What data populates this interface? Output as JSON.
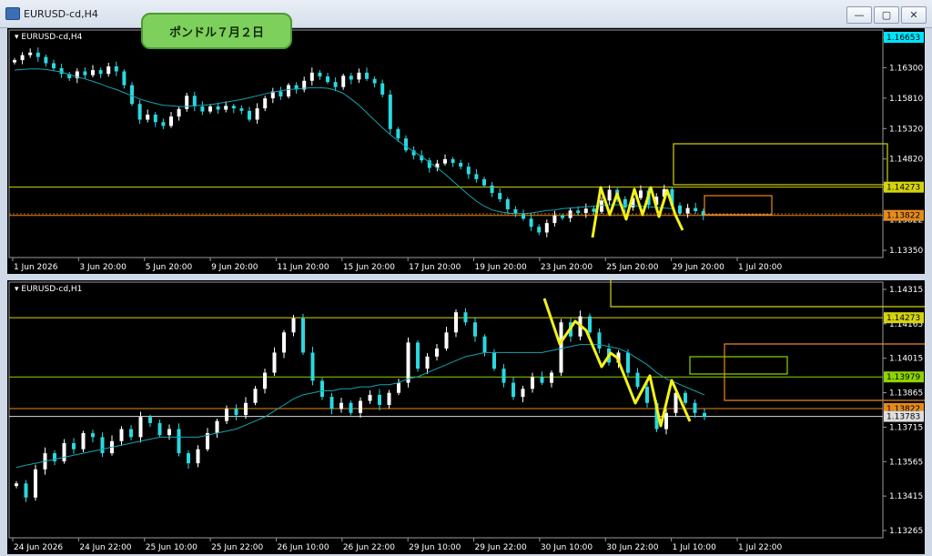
{
  "window": {
    "title": "EURUSD-cd,H4",
    "badge_text": "ポンドル７月２日",
    "controls": [
      "—",
      "▢",
      "✕"
    ]
  },
  "colors": {
    "bull": "#ffffff",
    "bear": "#2ad8e0",
    "ma": "#15a3b0",
    "level_yellow": "#d4d40c",
    "level_orange": "#e58a1c",
    "level_green": "#8fd400",
    "annotation": "#f2f21a",
    "axis_text": "#ffffff"
  },
  "chart_data": [
    {
      "type": "candlestick",
      "symbol_label": "EURUSD-cd,H4",
      "y_ticks": [
        "1.16653",
        "1.16300",
        "1.15810",
        "1.15320",
        "1.14820",
        "1.14273",
        "1.13822",
        "1.13350"
      ],
      "x_ticks": [
        "1 Jun 2026",
        "3 Jun 20:00",
        "5 Jun 20:00",
        "9 Jun 20:00",
        "11 Jun 20:00",
        "15 Jun 20:00",
        "17 Jun 20:00",
        "19 Jun 20:00",
        "23 Jun 20:00",
        "25 Jun 20:00",
        "29 Jun 20:00",
        "1 Jul 20:00"
      ],
      "ylim": [
        1.1315,
        1.1678
      ],
      "closes": [
        1.163,
        1.1638,
        1.1642,
        1.1635,
        1.1625,
        1.1617,
        1.1608,
        1.1601,
        1.1612,
        1.1606,
        1.1614,
        1.1608,
        1.162,
        1.1612,
        1.159,
        1.156,
        1.1535,
        1.1543,
        1.1531,
        1.1525,
        1.154,
        1.1552,
        1.1573,
        1.1556,
        1.1548,
        1.1556,
        1.1551,
        1.1557,
        1.1553,
        1.1549,
        1.1535,
        1.1553,
        1.1569,
        1.158,
        1.1572,
        1.159,
        1.1583,
        1.1597,
        1.161,
        1.1604,
        1.1595,
        1.1587,
        1.1605,
        1.1599,
        1.161,
        1.16,
        1.1593,
        1.1575,
        1.152,
        1.1505,
        1.1486,
        1.1478,
        1.147,
        1.1458,
        1.1465,
        1.1472,
        1.1466,
        1.146,
        1.1448,
        1.144,
        1.143,
        1.1418,
        1.1408,
        1.1392,
        1.1385,
        1.1377,
        1.1364,
        1.1355,
        1.137,
        1.1382,
        1.1378,
        1.139,
        1.1386,
        1.1393,
        1.1388,
        1.1406,
        1.1423,
        1.1408,
        1.1395,
        1.141,
        1.1422,
        1.1399,
        1.1412,
        1.1424,
        1.1398,
        1.1385,
        1.1394,
        1.1389,
        1.1382
      ],
      "ma": [
        1.1614,
        1.1615,
        1.1616,
        1.1616,
        1.1615,
        1.1613,
        1.1611,
        1.1607,
        1.1603,
        1.16,
        1.1596,
        1.1592,
        1.1587,
        1.1583,
        1.1578,
        1.1573,
        1.1568,
        1.1564,
        1.1561,
        1.1558,
        1.1557,
        1.1556,
        1.1556,
        1.1557,
        1.1558,
        1.1559,
        1.1561,
        1.1563,
        1.1565,
        1.1567,
        1.157,
        1.1573,
        1.1576,
        1.1579,
        1.1581,
        1.1583,
        1.1584,
        1.1585,
        1.1586,
        1.1586,
        1.1585,
        1.1582,
        1.1577,
        1.1568,
        1.1558,
        1.1546,
        1.1534,
        1.1522,
        1.1511,
        1.1501,
        1.1492,
        1.1484,
        1.1476,
        1.1467,
        1.1458,
        1.1448,
        1.1437,
        1.1426,
        1.1415,
        1.1405,
        1.1397,
        1.1391,
        1.1388,
        1.1386,
        1.1385,
        1.1385,
        1.1386,
        1.1388,
        1.139,
        1.1391,
        1.1393,
        1.1394,
        1.1395,
        1.1396,
        1.1397,
        1.1398,
        1.1399,
        1.1399,
        1.1399,
        1.1398,
        1.1397,
        1.1396,
        1.1395,
        1.1394,
        1.1393
      ],
      "levels": [
        {
          "price": 1.14273,
          "label": "1.14273",
          "color": "yellow"
        },
        {
          "price": 1.13822,
          "label": "1.13822",
          "color": "orange"
        }
      ],
      "current_label": "1.16653"
    },
    {
      "type": "candlestick",
      "symbol_label": "EURUSD-cd,H1",
      "y_ticks": [
        "1.14315",
        "1.14165",
        "1.14015",
        "1.13865",
        "1.13715",
        "1.13565",
        "1.13415",
        "1.13265"
      ],
      "x_ticks": [
        "24 Jun 2026",
        "24 Jun 22:00",
        "25 Jun 10:00",
        "25 Jun 22:00",
        "26 Jun 10:00",
        "26 Jun 22:00",
        "29 Jun 10:00",
        "29 Jun 22:00",
        "30 Jun 10:00",
        "30 Jun 22:00",
        "1 Jul 10:00",
        "1 Jul 22:00"
      ],
      "ylim": [
        1.1318,
        1.1445
      ],
      "closes": [
        1.1345,
        1.1338,
        1.1352,
        1.136,
        1.1356,
        1.1365,
        1.1362,
        1.137,
        1.1368,
        1.136,
        1.1366,
        1.1372,
        1.1368,
        1.1378,
        1.1375,
        1.1369,
        1.1372,
        1.136,
        1.1355,
        1.1362,
        1.137,
        1.1376,
        1.1382,
        1.1379,
        1.1385,
        1.1392,
        1.14,
        1.141,
        1.142,
        1.1427,
        1.141,
        1.1396,
        1.1388,
        1.1382,
        1.1385,
        1.138,
        1.1386,
        1.1389,
        1.1384,
        1.139,
        1.1395,
        1.1415,
        1.1402,
        1.1408,
        1.1412,
        1.142,
        1.143,
        1.1425,
        1.1418,
        1.141,
        1.1402,
        1.1395,
        1.1388,
        1.1392,
        1.1398,
        1.1395,
        1.14,
        1.1425,
        1.1418,
        1.1428,
        1.142,
        1.1412,
        1.1405,
        1.141,
        1.14,
        1.1393,
        1.1385,
        1.1372,
        1.138,
        1.139,
        1.1385,
        1.138,
        1.1378
      ],
      "ma": [
        1.1353,
        1.1354,
        1.1355,
        1.1356,
        1.1357,
        1.1358,
        1.1359,
        1.136,
        1.1361,
        1.1362,
        1.1363,
        1.1364,
        1.1365,
        1.1366,
        1.1367,
        1.1368,
        1.1368,
        1.1368,
        1.1368,
        1.1368,
        1.1369,
        1.137,
        1.1371,
        1.1372,
        1.1374,
        1.1376,
        1.1378,
        1.1381,
        1.1384,
        1.1387,
        1.1389,
        1.139,
        1.1391,
        1.1391,
        1.1392,
        1.1392,
        1.1393,
        1.1393,
        1.1394,
        1.1394,
        1.1395,
        1.1397,
        1.1398,
        1.14,
        1.1402,
        1.1404,
        1.1406,
        1.1408,
        1.1409,
        1.141,
        1.141,
        1.141,
        1.141,
        1.141,
        1.141,
        1.141,
        1.1411,
        1.1412,
        1.1413,
        1.1414,
        1.1414,
        1.1414,
        1.1413,
        1.1412,
        1.141,
        1.1407,
        1.1404,
        1.14,
        1.1397,
        1.1395,
        1.1393,
        1.1391,
        1.1389
      ],
      "levels": [
        {
          "price": 1.14273,
          "label": "1.14273",
          "color": "yellow"
        },
        {
          "price": 1.13979,
          "label": "1.13979",
          "color": "green"
        },
        {
          "price": 1.13822,
          "label": "1.13822",
          "color": "orange"
        },
        {
          "price": 1.13783,
          "label": "1.13783",
          "color": "white"
        }
      ],
      "current_label": "1.13783"
    }
  ]
}
